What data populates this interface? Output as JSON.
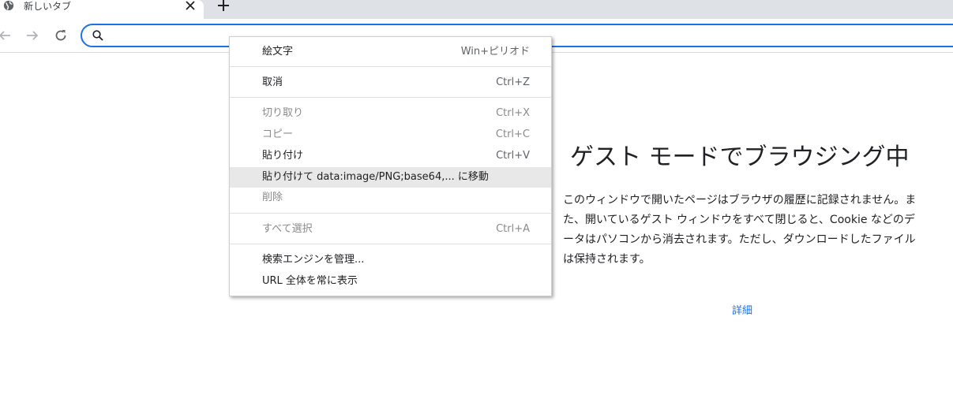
{
  "tab": {
    "title": "新しいタブ",
    "favicon": "globe-icon",
    "close_icon": "close-icon"
  },
  "tabstrip": {
    "new_tab_icon": "plus-icon"
  },
  "toolbar": {
    "back_icon": "arrow-left-icon",
    "forward_icon": "arrow-right-icon",
    "reload_icon": "reload-icon",
    "omnibox": {
      "value": "",
      "placeholder": "",
      "icon": "search-icon"
    }
  },
  "page": {
    "title": "ゲスト モードでブラウジング中",
    "description": "このウィンドウで開いたページはブラウザの履歴に記録されません。また、開いているゲスト ウィンドウをすべて閉じると、Cookie などのデータはパソコンから消去されます。ただし、ダウンロードしたファイルは保持されます。",
    "link": "詳細"
  },
  "context_menu": {
    "items": [
      {
        "label": "絵文字",
        "shortcut": "Win+ピリオド",
        "enabled": true,
        "highlighted": false
      },
      {
        "label": "取消",
        "shortcut": "Ctrl+Z",
        "enabled": true,
        "highlighted": false
      },
      {
        "label": "切り取り",
        "shortcut": "Ctrl+X",
        "enabled": false,
        "highlighted": false
      },
      {
        "label": "コピー",
        "shortcut": "Ctrl+C",
        "enabled": false,
        "highlighted": false
      },
      {
        "label": "貼り付け",
        "shortcut": "Ctrl+V",
        "enabled": true,
        "highlighted": false
      },
      {
        "label": "貼り付けて data:image/PNG;base64,... に移動",
        "shortcut": "",
        "enabled": true,
        "highlighted": true
      },
      {
        "label": "削除",
        "shortcut": "",
        "enabled": false,
        "highlighted": false
      },
      {
        "label": "すべて選択",
        "shortcut": "Ctrl+A",
        "enabled": false,
        "highlighted": false
      },
      {
        "label": "検索エンジンを管理...",
        "shortcut": "",
        "enabled": true,
        "highlighted": false
      },
      {
        "label": "URL 全体を常に表示",
        "shortcut": "",
        "enabled": true,
        "highlighted": false
      }
    ]
  },
  "colors": {
    "accent": "#1a73e8",
    "tabstrip_bg": "#dee1e6",
    "menu_highlight": "#e8e8e9",
    "disabled_text": "#8a8a8a"
  }
}
